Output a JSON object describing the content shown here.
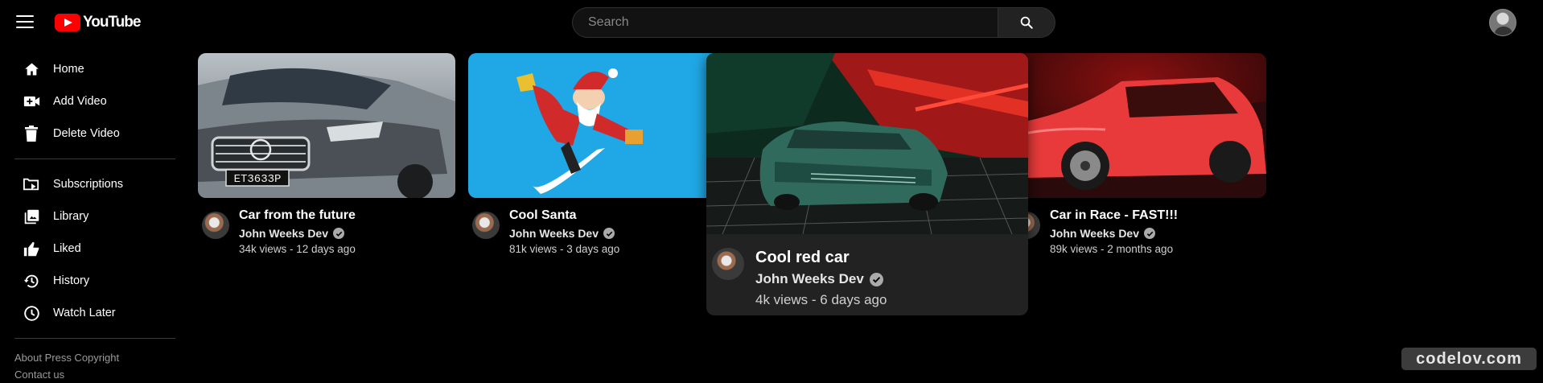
{
  "app": {
    "logo_text": "YouTube"
  },
  "search": {
    "placeholder": "Search"
  },
  "sidebar": {
    "main": [
      {
        "label": "Home",
        "icon": "home-icon"
      },
      {
        "label": "Add Video",
        "icon": "add-video-icon"
      },
      {
        "label": "Delete Video",
        "icon": "trash-icon"
      }
    ],
    "secondary": [
      {
        "label": "Subscriptions",
        "icon": "subscriptions-icon"
      },
      {
        "label": "Library",
        "icon": "library-icon"
      },
      {
        "label": "Liked",
        "icon": "thumbs-up-icon"
      },
      {
        "label": "History",
        "icon": "history-icon"
      },
      {
        "label": "Watch Later",
        "icon": "clock-icon"
      }
    ],
    "footer": {
      "line1": "About Press Copyright",
      "line2": "Contact us"
    }
  },
  "videos": [
    {
      "title": "Car from the future",
      "channel": "John Weeks Dev",
      "stats": "34k views - 12 days ago"
    },
    {
      "title": "Cool Santa",
      "channel": "John Weeks Dev",
      "stats": "81k views - 3 days ago"
    },
    {
      "title": "Cool red car",
      "channel": "John Weeks Dev",
      "stats": "4k views - 6 days ago"
    },
    {
      "title": "Car in Race - FAST!!!",
      "channel": "John Weeks Dev",
      "stats": "89k views - 2 months ago"
    }
  ],
  "watermark": "codelov.com",
  "colors": {
    "brand_red": "#ff0000",
    "background": "#000000",
    "hover_card": "#222222"
  }
}
